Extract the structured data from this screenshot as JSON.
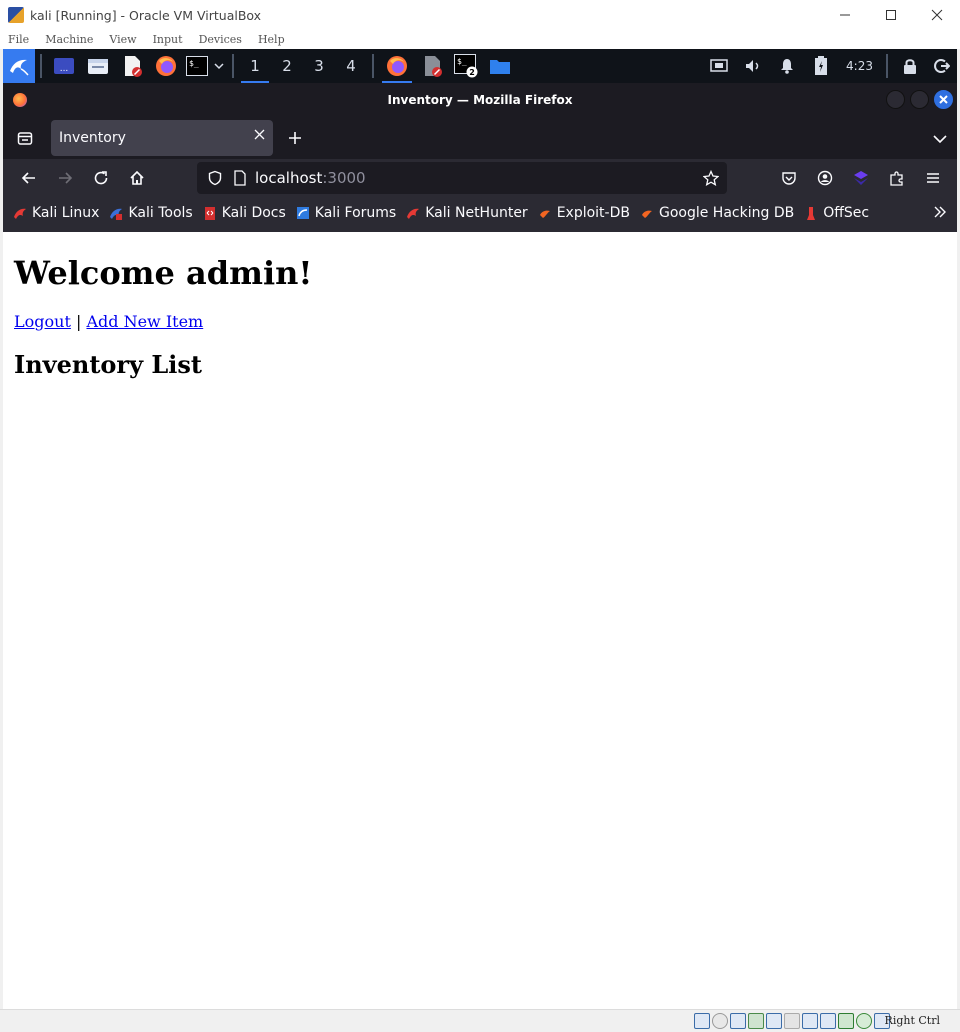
{
  "virtualbox": {
    "title": "kali [Running] - Oracle VM VirtualBox",
    "menu": [
      "File",
      "Machine",
      "View",
      "Input",
      "Devices",
      "Help"
    ],
    "host_key": "Right Ctrl"
  },
  "kali_panel": {
    "workspaces": [
      "1",
      "2",
      "3",
      "4"
    ],
    "active_workspace": "1",
    "terminal_badge": "2",
    "clock": "4:23",
    "terminal_glyph": "$_",
    "menu_glyph": "..."
  },
  "firefox": {
    "window_title": "Inventory — Mozilla Firefox",
    "tab": {
      "label": "Inventory"
    },
    "url": {
      "host": "localhost",
      "port": ":3000"
    },
    "bookmarks": [
      {
        "label": "Kali Linux",
        "icon": "kali-dragon-icon",
        "color": "#e53935"
      },
      {
        "label": "Kali Tools",
        "icon": "kali-tools-icon",
        "color": "#3b6fd8"
      },
      {
        "label": "Kali Docs",
        "icon": "kali-docs-icon",
        "color": "#d32f2f"
      },
      {
        "label": "Kali Forums",
        "icon": "kali-forums-icon",
        "color": "#2f7be0"
      },
      {
        "label": "Kali NetHunter",
        "icon": "nethunter-icon",
        "color": "#e53935"
      },
      {
        "label": "Exploit-DB",
        "icon": "exploit-db-icon",
        "color": "#f26522"
      },
      {
        "label": "Google Hacking DB",
        "icon": "ghdb-icon",
        "color": "#f26522"
      },
      {
        "label": "OffSec",
        "icon": "offsec-icon",
        "color": "#e53935"
      }
    ]
  },
  "page": {
    "heading": "Welcome admin!",
    "logout_link": "Logout",
    "separator": "|",
    "add_item_link": "Add New Item",
    "list_heading": "Inventory List"
  },
  "colors": {
    "link": "#0000ee",
    "accent": "#367bf0",
    "firefox_dark": "#1c1b22"
  }
}
